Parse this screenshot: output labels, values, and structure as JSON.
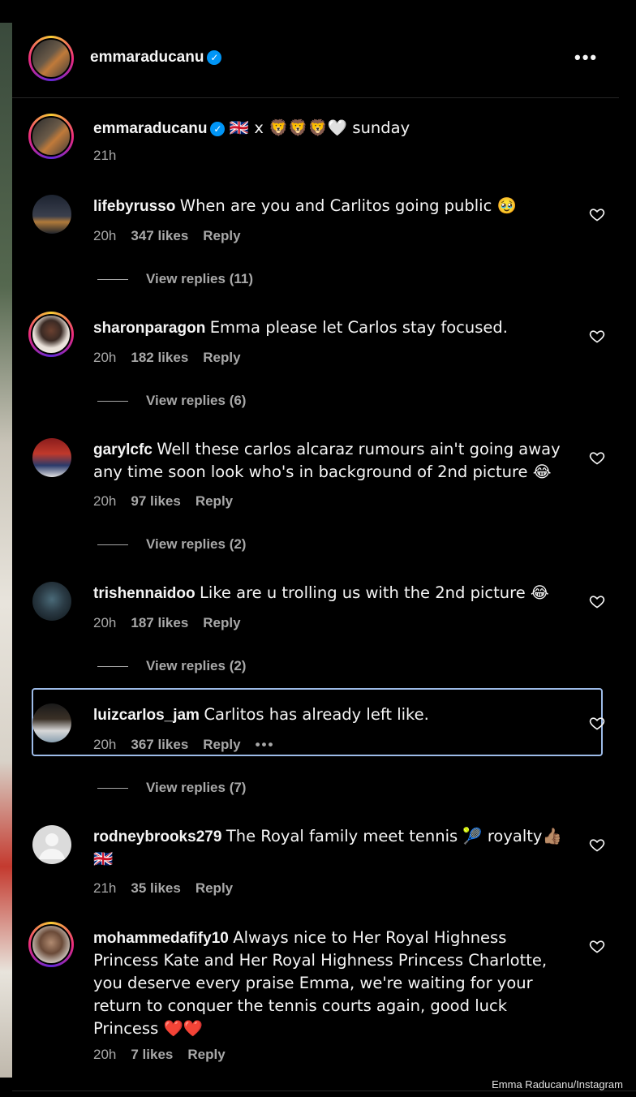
{
  "post": {
    "username": "emmaraducanu",
    "more_label": "•••",
    "caption": {
      "username": "emmaraducanu",
      "text": "🇬🇧 x 🦁🦁🦁🤍 sunday",
      "time": "21h"
    }
  },
  "comments": [
    {
      "username": "lifebyrusso",
      "text": "When are you and Carlitos going public 🥹",
      "time": "20h",
      "likes": "347 likes",
      "reply": "Reply",
      "view_replies": "View replies (11)"
    },
    {
      "username": "sharonparagon",
      "text": "Emma please let Carlos stay focused.",
      "time": "20h",
      "likes": "182 likes",
      "reply": "Reply",
      "view_replies": "View replies (6)"
    },
    {
      "username": "garylcfc",
      "text": "Well these carlos alcaraz rumours ain't going away any time soon look who's in background of 2nd picture 😂",
      "time": "20h",
      "likes": "97 likes",
      "reply": "Reply",
      "view_replies": "View replies (2)"
    },
    {
      "username": "trishennaidoo",
      "text": "Like are u trolling us with the 2nd picture 😂",
      "time": "20h",
      "likes": "187 likes",
      "reply": "Reply",
      "view_replies": "View replies (2)"
    },
    {
      "username": "luizcarlos_jam",
      "text": "Carlitos has already left like.",
      "time": "20h",
      "likes": "367 likes",
      "reply": "Reply",
      "more": "•••",
      "view_replies": "View replies (7)"
    },
    {
      "username": "rodneybrooks279",
      "text": "The Royal family meet tennis 🎾 royalty👍🏽 🇬🇧",
      "time": "21h",
      "likes": "35 likes",
      "reply": "Reply"
    },
    {
      "username": "mohammedafify10",
      "text": "Always nice to Her Royal Highness Princess Kate and Her Royal Highness Princess Charlotte, you deserve every praise Emma, we're waiting for your return to conquer the tennis courts again, good luck Princess ❤️❤️",
      "time": "20h",
      "likes": "7 likes",
      "reply": "Reply"
    }
  ],
  "credit": "Emma Raducanu/Instagram",
  "colors": {
    "background": "#000000",
    "text": "#f5f5f5",
    "muted": "#a8a8a8",
    "verified": "#0095f6",
    "highlight": "#9dbbe8"
  }
}
